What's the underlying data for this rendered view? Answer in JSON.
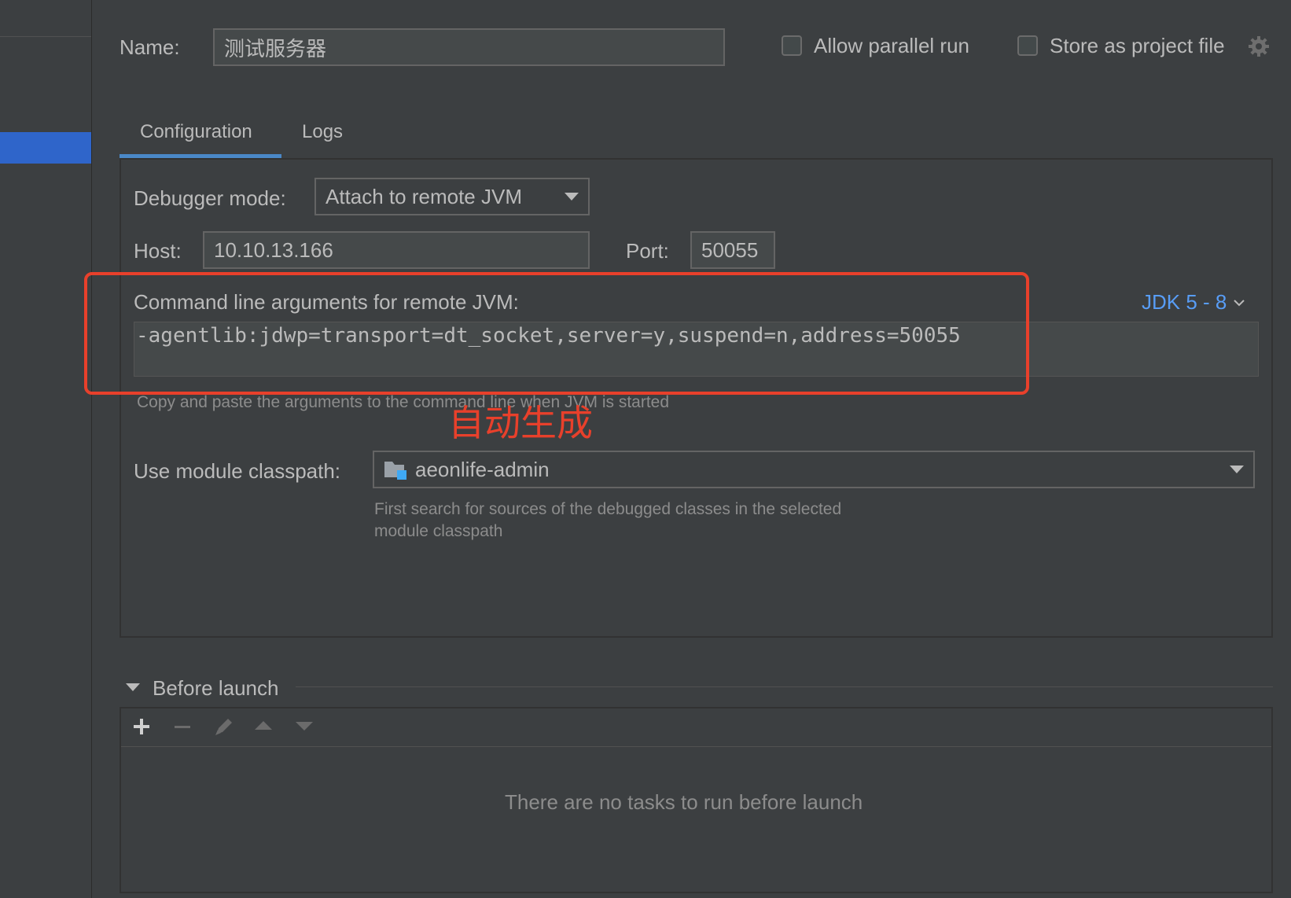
{
  "header": {
    "name_label": "Name:",
    "name_value": "测试服务器",
    "allow_parallel_label": "Allow parallel run",
    "store_project_label": "Store as project file"
  },
  "tabs": [
    {
      "label": "Configuration",
      "active": true
    },
    {
      "label": "Logs",
      "active": false
    }
  ],
  "config": {
    "debugger_mode_label": "Debugger mode:",
    "debugger_mode_value": "Attach to remote JVM",
    "host_label": "Host:",
    "host_value": "10.10.13.166",
    "port_label": "Port:",
    "port_value": "50055",
    "cmd_label": "Command line arguments for remote JVM:",
    "jdk_link": "JDK 5 - 8",
    "cmd_value": "-agentlib:jdwp=transport=dt_socket,server=y,suspend=n,address=50055",
    "cmd_hint": "Copy and paste the arguments to the command line when JVM is started",
    "annotation": "自动生成",
    "module_label": "Use module classpath:",
    "module_value": "aeonlife-admin",
    "module_hint_line1": "First search for sources of the debugged classes in the selected",
    "module_hint_line2": "module classpath"
  },
  "before_launch": {
    "title": "Before launch",
    "empty_text": "There are no tasks to run before launch"
  },
  "icons": {
    "gear": "gear-icon",
    "add": "plus-icon",
    "remove": "minus-icon",
    "edit": "pencil-icon",
    "move_up": "arrow-up-icon",
    "move_down": "arrow-down-icon",
    "module": "module-folder-icon"
  },
  "colors": {
    "background": "#3c3f41",
    "selection": "#2f65ca",
    "tab_underline": "#4a88c7",
    "link": "#589df6",
    "annotation": "#e8402b"
  }
}
